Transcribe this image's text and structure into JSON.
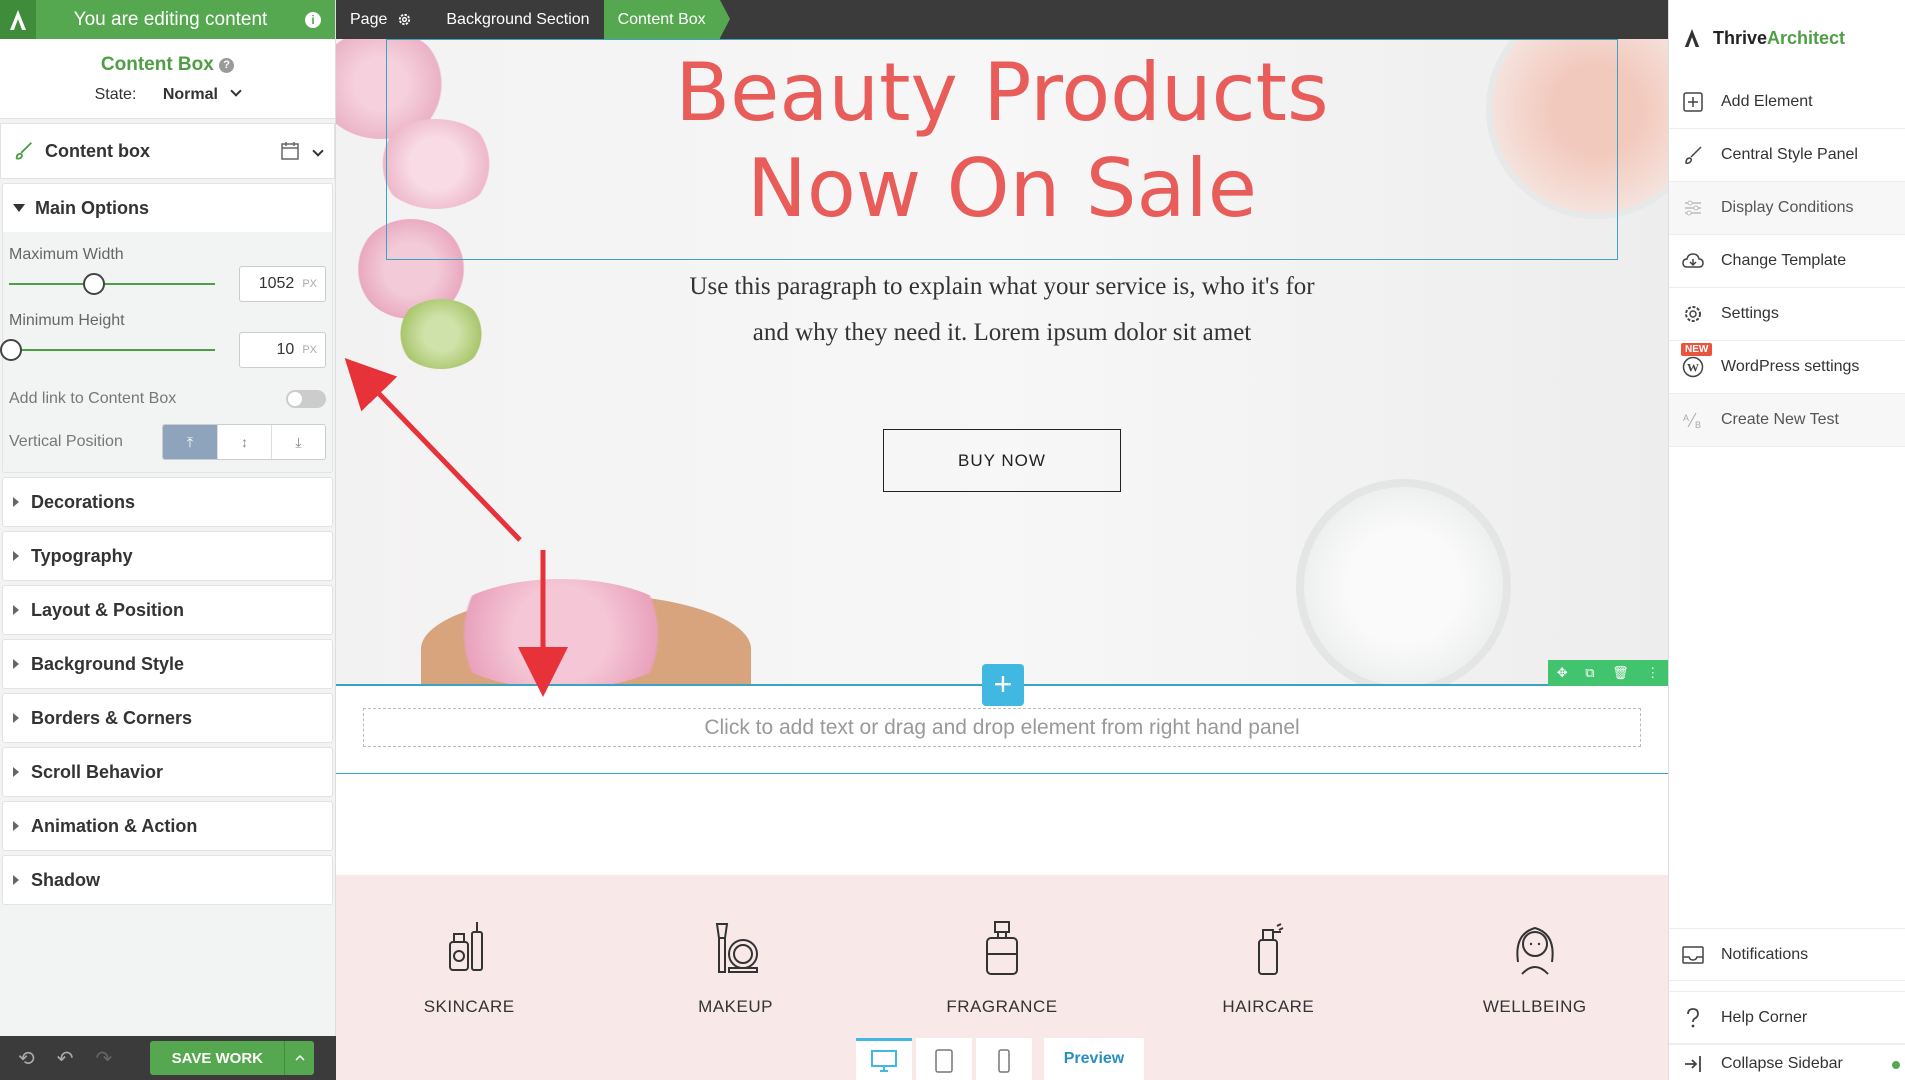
{
  "editor": {
    "editing_banner": "You are editing content",
    "element_name": "Content Box",
    "state_label": "State:",
    "state_value": "Normal",
    "element_row_label": "Content box"
  },
  "main_options": {
    "title": "Main Options",
    "max_width_label": "Maximum Width",
    "max_width_value": "1052",
    "max_width_unit": "PX",
    "max_width_fraction": 0.41,
    "min_height_label": "Minimum Height",
    "min_height_value": "10",
    "min_height_unit": "PX",
    "min_height_fraction": 0.0,
    "link_label": "Add link to Content Box",
    "vertical_position_label": "Vertical Position"
  },
  "panel_sections": [
    "Decorations",
    "Typography",
    "Layout & Position",
    "Background Style",
    "Borders & Corners",
    "Scroll Behavior",
    "Animation & Action",
    "Shadow"
  ],
  "footer": {
    "save_label": "SAVE WORK"
  },
  "breadcrumbs": [
    "Page",
    "Background Section",
    "Content Box"
  ],
  "canvas": {
    "heading_line1": "Beauty Products",
    "heading_line2": "Now On Sale",
    "paragraph_line1": "Use this paragraph to explain what your service is, who it's for",
    "paragraph_line2": "and why they need it. Lorem ipsum dolor sit amet",
    "button_label": "BUY NOW",
    "drop_placeholder": "Click to add text or drag and drop element from right hand panel",
    "categories": [
      "SKINCARE",
      "MAKEUP",
      "FRAGRANCE",
      "HAIRCARE",
      "WELLBEING"
    ],
    "preview_label": "Preview"
  },
  "sidebar": {
    "brand_part1": "Thrive",
    "brand_part2": "Architect",
    "items": [
      {
        "label": "Add Element",
        "icon": "plus-square-icon"
      },
      {
        "label": "Central Style Panel",
        "icon": "brush-icon"
      },
      {
        "label": "Display Conditions",
        "icon": "sliders-icon"
      },
      {
        "label": "Change Template",
        "icon": "cloud-download-icon"
      },
      {
        "label": "Settings",
        "icon": "gear-icon"
      },
      {
        "label": "WordPress settings",
        "icon": "wordpress-icon",
        "badge": "NEW"
      },
      {
        "label": "Create New Test",
        "icon": "ab-test-icon"
      }
    ],
    "bottom_items": [
      {
        "label": "Notifications",
        "icon": "inbox-icon"
      },
      {
        "label": "Help Corner",
        "icon": "question-icon"
      },
      {
        "label": "Collapse Sidebar",
        "icon": "collapse-icon"
      }
    ]
  },
  "colors": {
    "accent_green": "#55a84f",
    "heading_coral": "#e85d5a",
    "selection_blue": "#41b8e2",
    "annotation_red": "#e8323a"
  }
}
